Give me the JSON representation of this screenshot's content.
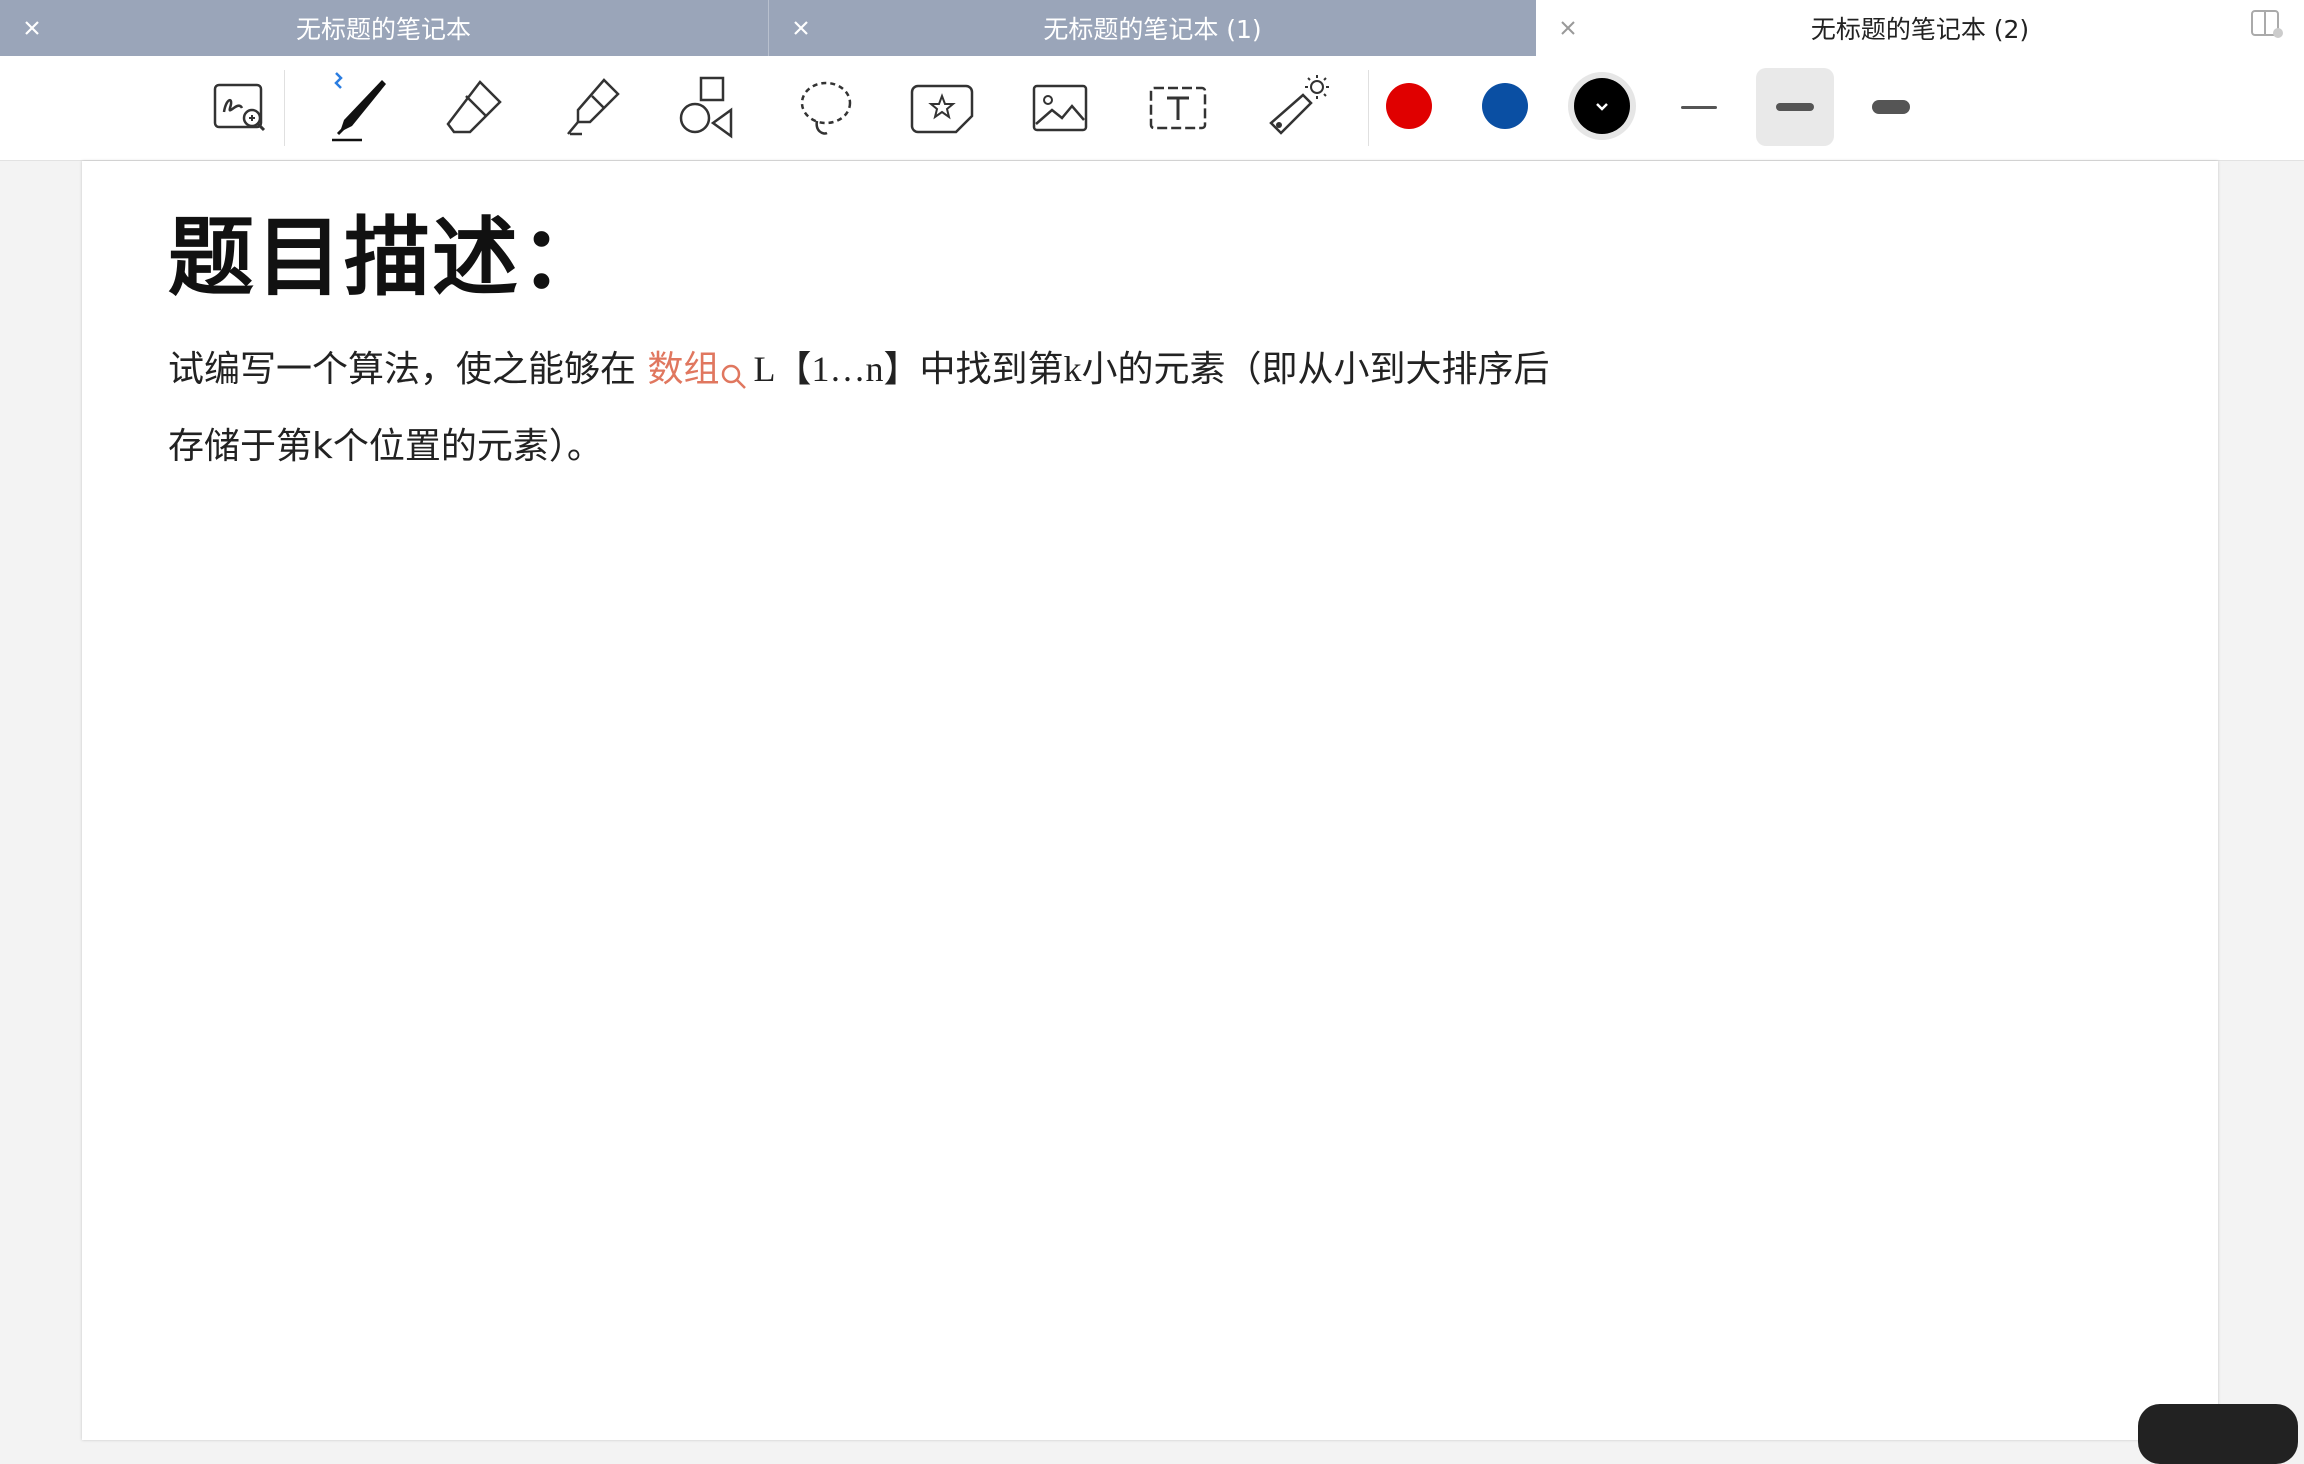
{
  "tabs": [
    {
      "title": "无标题的笔记本",
      "active": false
    },
    {
      "title": "无标题的笔记本 (1)",
      "active": false
    },
    {
      "title": "无标题的笔记本 (2)",
      "active": true
    }
  ],
  "toolbar": {
    "tools": [
      "zoom-writing",
      "pen",
      "eraser",
      "highlighter",
      "shapes",
      "lasso",
      "sticker",
      "image",
      "text",
      "laser-pointer"
    ],
    "bluetooth_indicator": "bluetooth-icon",
    "colors": [
      "#e00000",
      "#0a4fa3",
      "#000000"
    ],
    "selected_color": "#000000",
    "stroke_widths": [
      "thin",
      "medium",
      "thick"
    ],
    "selected_stroke": "medium"
  },
  "document": {
    "heading": "题目描述：",
    "line1_before": "试编写一个算法，使之能够在",
    "line1_link": "数组",
    "line1_after": "L【1…n】中找到第k小的元素（即从小到大排序后",
    "line2": "存储于第k个位置的元素）。"
  }
}
